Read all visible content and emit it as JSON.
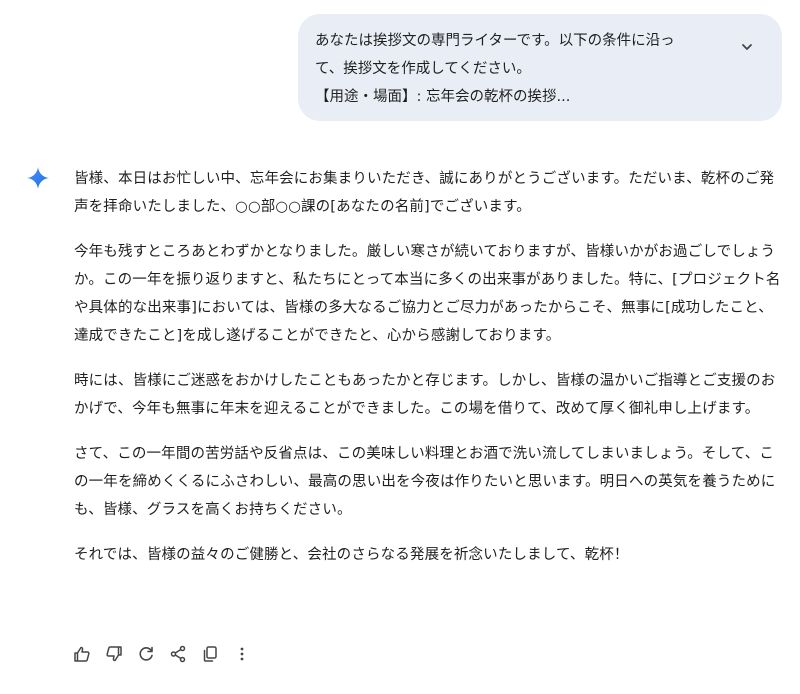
{
  "prompt": {
    "lines": [
      "あなたは挨拶文の専門ライターです。以下の条件に沿っ",
      "て、挨拶文を作成してください。",
      "【用途・場面】: 忘年会の乾杯の挨拶..."
    ],
    "expand_icon": "chevron-down-icon"
  },
  "response": {
    "paragraphs": [
      "皆様、本日はお忙しい中、忘年会にお集まりいただき、誠にありがとうございます。ただいま、乾杯のご発声を拝命いたしました、○○部○○課の[あなたの名前]でございます。",
      "今年も残すところあとわずかとなりました。厳しい寒さが続いておりますが、皆様いかがお過ごしでしょうか。この一年を振り返りますと、私たちにとって本当に多くの出来事がありました。特に、[プロジェクト名や具体的な出来事]においては、皆様の多大なるご協力とご尽力があったからこそ、無事に[成功したこと、達成できたこと]を成し遂げることができたと、心から感謝しております。",
      "時には、皆様にご迷惑をおかけしたこともあったかと存じます。しかし、皆様の温かいご指導とご支援のおかげで、今年も無事に年末を迎えることができました。この場を借りて、改めて厚く御礼申し上げます。",
      "さて、この一年間の苦労話や反省点は、この美味しい料理とお酒で洗い流してしまいましょう。そして、この一年を締めくくるにふさわしい、最高の思い出を今夜は作りたいと思います。明日への英気を養うためにも、皆様、グラスを高くお持ちください。",
      "それでは、皆様の益々のご健勝と、会社のさらなる発展を祈念いたしまして、乾杯！"
    ]
  },
  "actions": [
    "thumbs-up-icon",
    "thumbs-down-icon",
    "regenerate-icon",
    "share-icon",
    "copy-icon",
    "more-vert-icon"
  ],
  "colors": {
    "prompt_bubble": "#e9eef6",
    "text": "#1f1f1f",
    "icon": "#444746",
    "gem_start": "#4f8cf7",
    "gem_end": "#1a73e8"
  }
}
